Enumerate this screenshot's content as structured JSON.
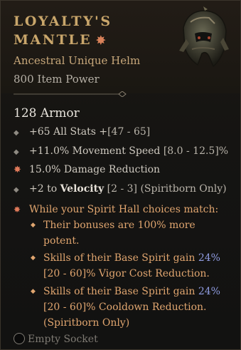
{
  "item": {
    "name": "Loyalty's Mantle",
    "type": "Ancestral Unique Helm",
    "item_power": "800 Item Power",
    "armor": "128 Armor"
  },
  "affixes": [
    {
      "text": "+65 All Stats +",
      "range": "[47 - 65]"
    },
    {
      "text": "+11.0% Movement Speed ",
      "range": "[8.0 - 12.5]%"
    },
    {
      "text": "15.0% Damage Reduction",
      "range": ""
    },
    {
      "pre": "+2 to ",
      "bold": "Velocity",
      "range": " [2 - 3] (Spiritborn Only)"
    }
  ],
  "aspect": {
    "header": "While your Spirit Hall choices match:",
    "items": [
      {
        "line1": "Their bonuses are 100% more",
        "line2": "potent."
      },
      {
        "line1_pre": "Skills of their Base Spirit gain ",
        "line1_num": "24%",
        "line2": "[20 - 60]% Vigor Cost Reduction."
      },
      {
        "line1_pre": "Skills of their Base Spirit gain ",
        "line1_num": "24%",
        "line2": "[20 - 60]% Cooldown Reduction.",
        "line3": "(Spiritborn Only)"
      }
    ]
  },
  "socket": {
    "label": "Empty Socket"
  },
  "colors": {
    "title": "#c9a66b",
    "aspect_text": "#e0a56f",
    "number_highlight": "#8f9be0",
    "greater_affix": "#e07a5a"
  },
  "icons": [
    "unique-star-icon",
    "helm-art-icon",
    "divider-ornament-icon",
    "bullet-icon",
    "greater-affix-star-icon",
    "socket-ring-icon"
  ]
}
